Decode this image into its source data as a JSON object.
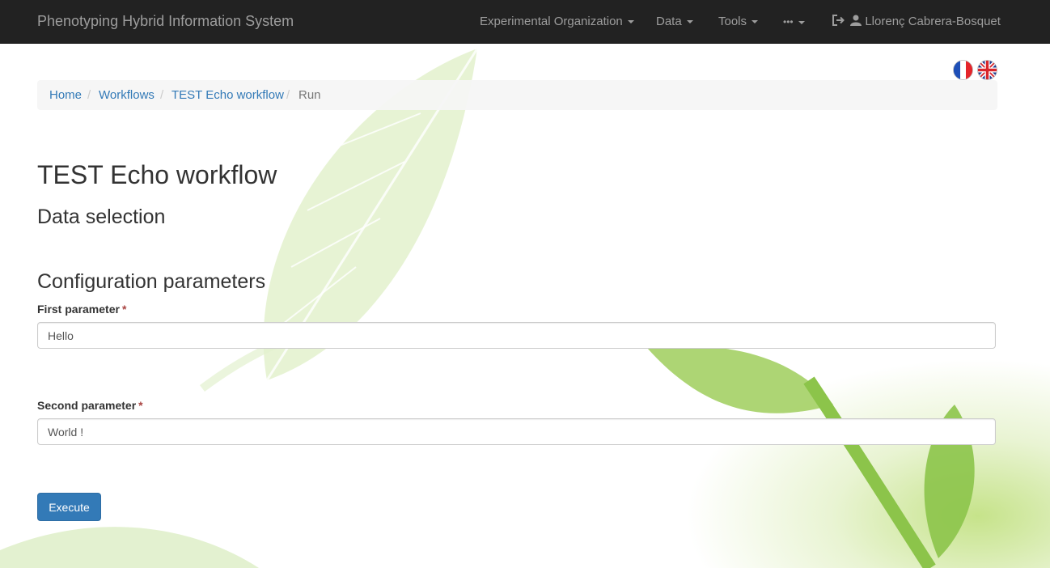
{
  "navbar": {
    "brand": "Phenotyping Hybrid Information System",
    "items": [
      {
        "label": "Experimental Organization"
      },
      {
        "label": "Data"
      },
      {
        "label": "Tools"
      },
      {
        "label": "•••"
      }
    ],
    "user": "Llorenç Cabrera-Bosquet"
  },
  "languages": [
    "French",
    "English"
  ],
  "breadcrumb": {
    "home": "Home",
    "workflows": "Workflows",
    "workflow": "TEST Echo workflow",
    "current": "Run"
  },
  "page": {
    "title": "TEST Echo workflow",
    "data_selection": "Data selection",
    "config_title": "Configuration parameters"
  },
  "form": {
    "first_label": "First parameter",
    "first_value": "Hello",
    "second_label": "Second parameter",
    "second_value": "World !",
    "required_mark": "*",
    "execute_label": "Execute"
  },
  "colors": {
    "navbar_bg": "#222222",
    "link": "#337ab7",
    "primary_button": "#337ab7",
    "required": "#a94442"
  }
}
